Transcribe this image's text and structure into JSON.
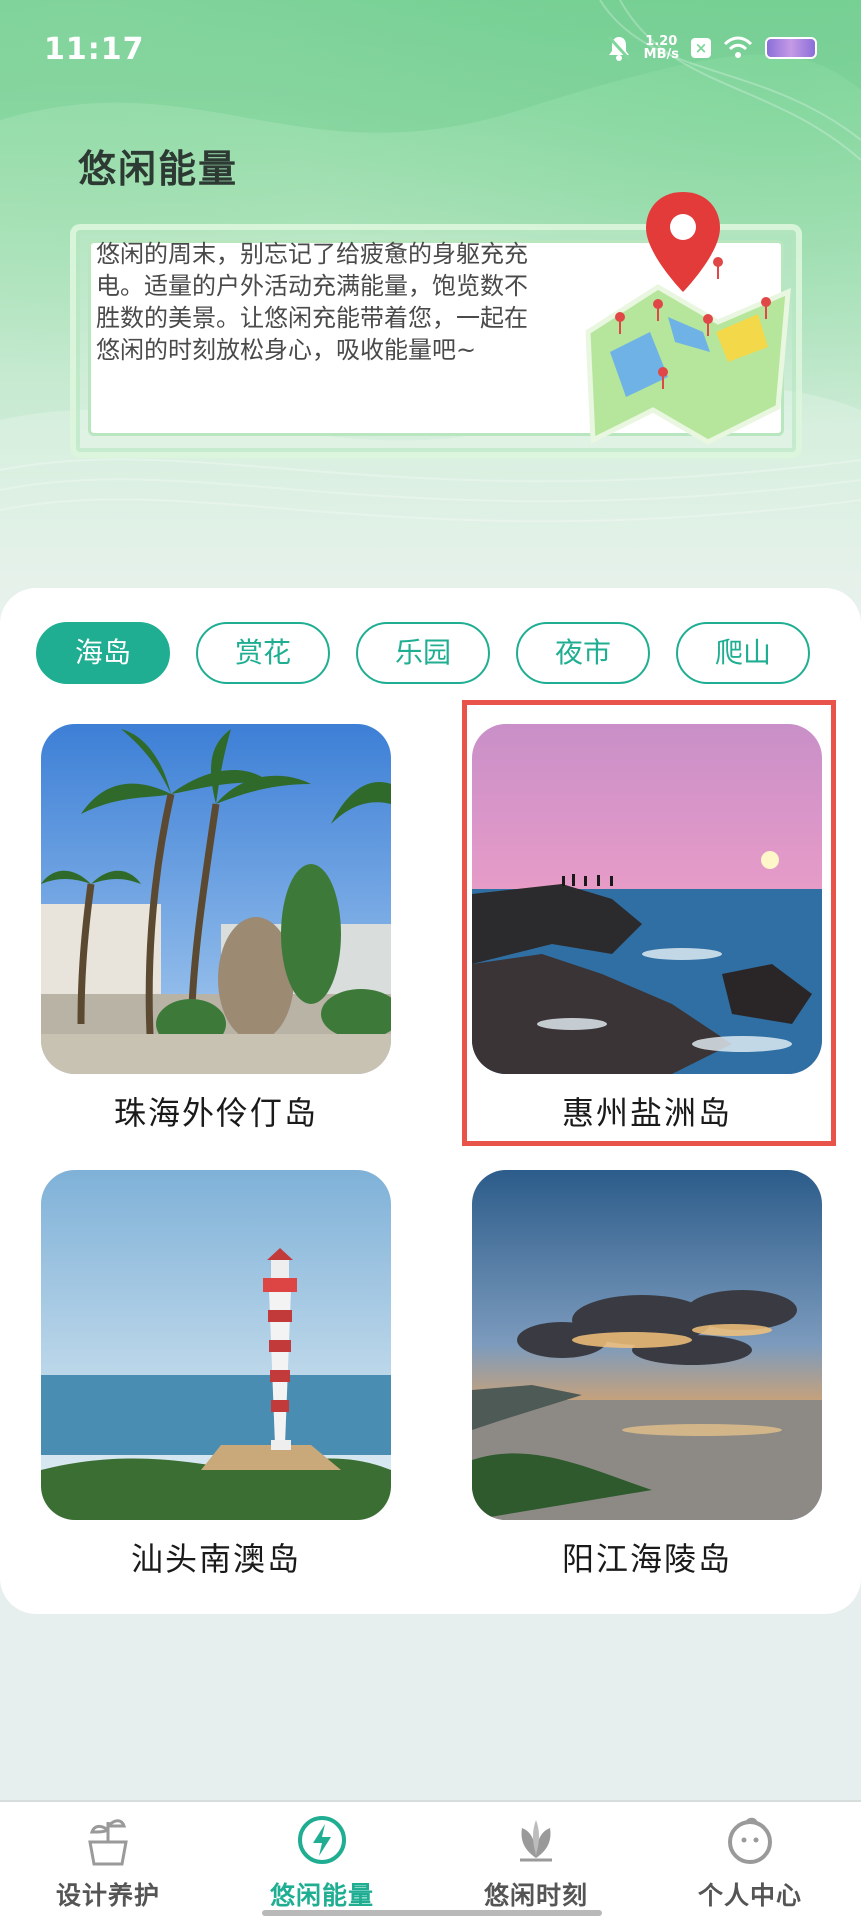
{
  "status_bar": {
    "time": "11:17",
    "speed_value": "1.20",
    "speed_unit": "MB/s"
  },
  "header": {
    "title": "悠闲能量",
    "description": "悠闲的周末，别忘记了给疲惫的身躯充充电。适量的户外活动充满能量，饱览数不胜数的美景。让悠闲充能带着您，一起在悠闲的时刻放松身心，吸收能量吧~"
  },
  "tabs": [
    {
      "label": "海岛",
      "active": true
    },
    {
      "label": "赏花",
      "active": false
    },
    {
      "label": "乐园",
      "active": false
    },
    {
      "label": "夜市",
      "active": false
    },
    {
      "label": "爬山",
      "active": false
    }
  ],
  "places": [
    {
      "name": "珠海外伶仃岛",
      "image": "palm-trees-rock-photo"
    },
    {
      "name": "惠州盐洲岛",
      "image": "sunset-rocky-coast-photo"
    },
    {
      "name": "汕头南澳岛",
      "image": "lighthouse-photo"
    },
    {
      "name": "阳江海陵岛",
      "image": "cloudy-sunset-bay-photo"
    }
  ],
  "bottom_nav": [
    {
      "label": "设计养护",
      "icon": "plant-pot-icon",
      "active": false
    },
    {
      "label": "悠闲能量",
      "icon": "lightning-icon",
      "active": true
    },
    {
      "label": "悠闲时刻",
      "icon": "leaf-icon",
      "active": false
    },
    {
      "label": "个人中心",
      "icon": "face-icon",
      "active": false
    }
  ],
  "colors": {
    "accent": "#1fae92",
    "highlight": "#e8534a"
  }
}
